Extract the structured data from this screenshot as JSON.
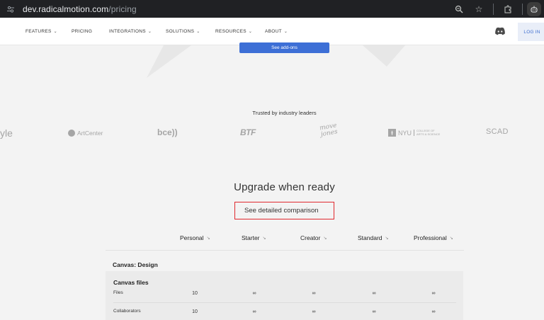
{
  "browser": {
    "url_main": "dev.radicalmotion.com",
    "url_path": "/pricing",
    "site_info_icon": "tune-icon",
    "zoom_icon": "zoom-icon",
    "bookmark_icon": "star-icon",
    "extensions_icon": "puzzle-icon",
    "profile_icon": "profile-icon"
  },
  "nav": {
    "items": [
      {
        "label": "FEATURES",
        "has_menu": true
      },
      {
        "label": "PRICING",
        "has_menu": false
      },
      {
        "label": "INTEGRATIONS",
        "has_menu": true
      },
      {
        "label": "SOLUTIONS",
        "has_menu": true
      },
      {
        "label": "RESOURCES",
        "has_menu": true
      },
      {
        "label": "ABOUT",
        "has_menu": true
      }
    ],
    "chevron": "⌄",
    "login_label": "LOG IN",
    "discord_icon": "discord-icon"
  },
  "hero": {
    "addons_button": "See add-ons"
  },
  "trusted": {
    "heading": "Trusted by industry leaders",
    "logos": [
      "yle",
      "ArtCenter",
      "bce))",
      "BTF",
      "move jones",
      "NYU",
      "COLLEGE OF ARTS & SCIENCE",
      "SCAD"
    ]
  },
  "upgrade": {
    "heading": "Upgrade when ready",
    "compare_link": "See detailed comparison"
  },
  "table": {
    "sort_icon": "↘",
    "plans": [
      "Personal",
      "Starter",
      "Creator",
      "Standard",
      "Professional"
    ],
    "section": "Canvas: Design",
    "group": "Canvas files",
    "rows": [
      {
        "label": "Files",
        "values": [
          "10",
          "∞",
          "∞",
          "∞",
          "∞"
        ]
      },
      {
        "label": "Collaborators",
        "values": [
          "10",
          "∞",
          "∞",
          "∞",
          "∞"
        ]
      }
    ]
  },
  "colors": {
    "accent": "#3d6fd6",
    "highlight_box": "#e0282e"
  }
}
